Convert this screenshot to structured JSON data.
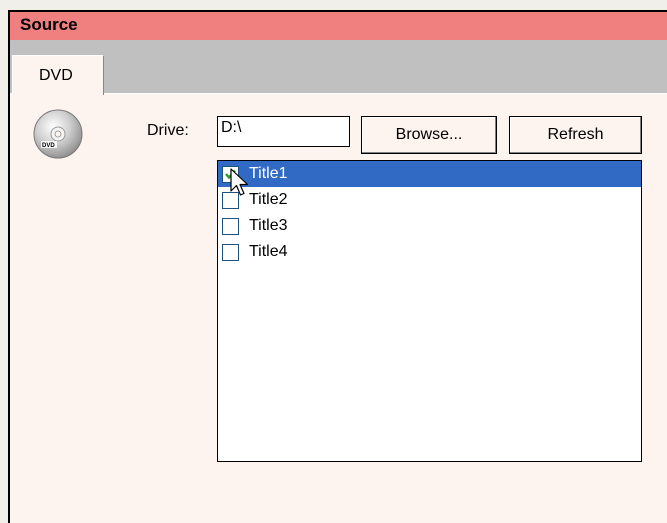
{
  "header": {
    "title": "Source"
  },
  "tabs": [
    {
      "label": "DVD",
      "active": true
    }
  ],
  "icons": {
    "disc": "dvd-disc-icon",
    "cursor": "mouse-pointer-icon",
    "check": "checkmark-icon"
  },
  "drive": {
    "label": "Drive:",
    "value": "D:\\"
  },
  "buttons": {
    "browse": "Browse...",
    "refresh": "Refresh"
  },
  "titles": [
    {
      "label": "Title1",
      "checked": true,
      "selected": true
    },
    {
      "label": "Title2",
      "checked": false,
      "selected": false
    },
    {
      "label": "Title3",
      "checked": false,
      "selected": false
    },
    {
      "label": "Title4",
      "checked": false,
      "selected": false
    }
  ],
  "colors": {
    "header_bg": "#f08080",
    "panel_bg": "#fdf4f0",
    "selection": "#316ac5",
    "check": "#22a022"
  }
}
